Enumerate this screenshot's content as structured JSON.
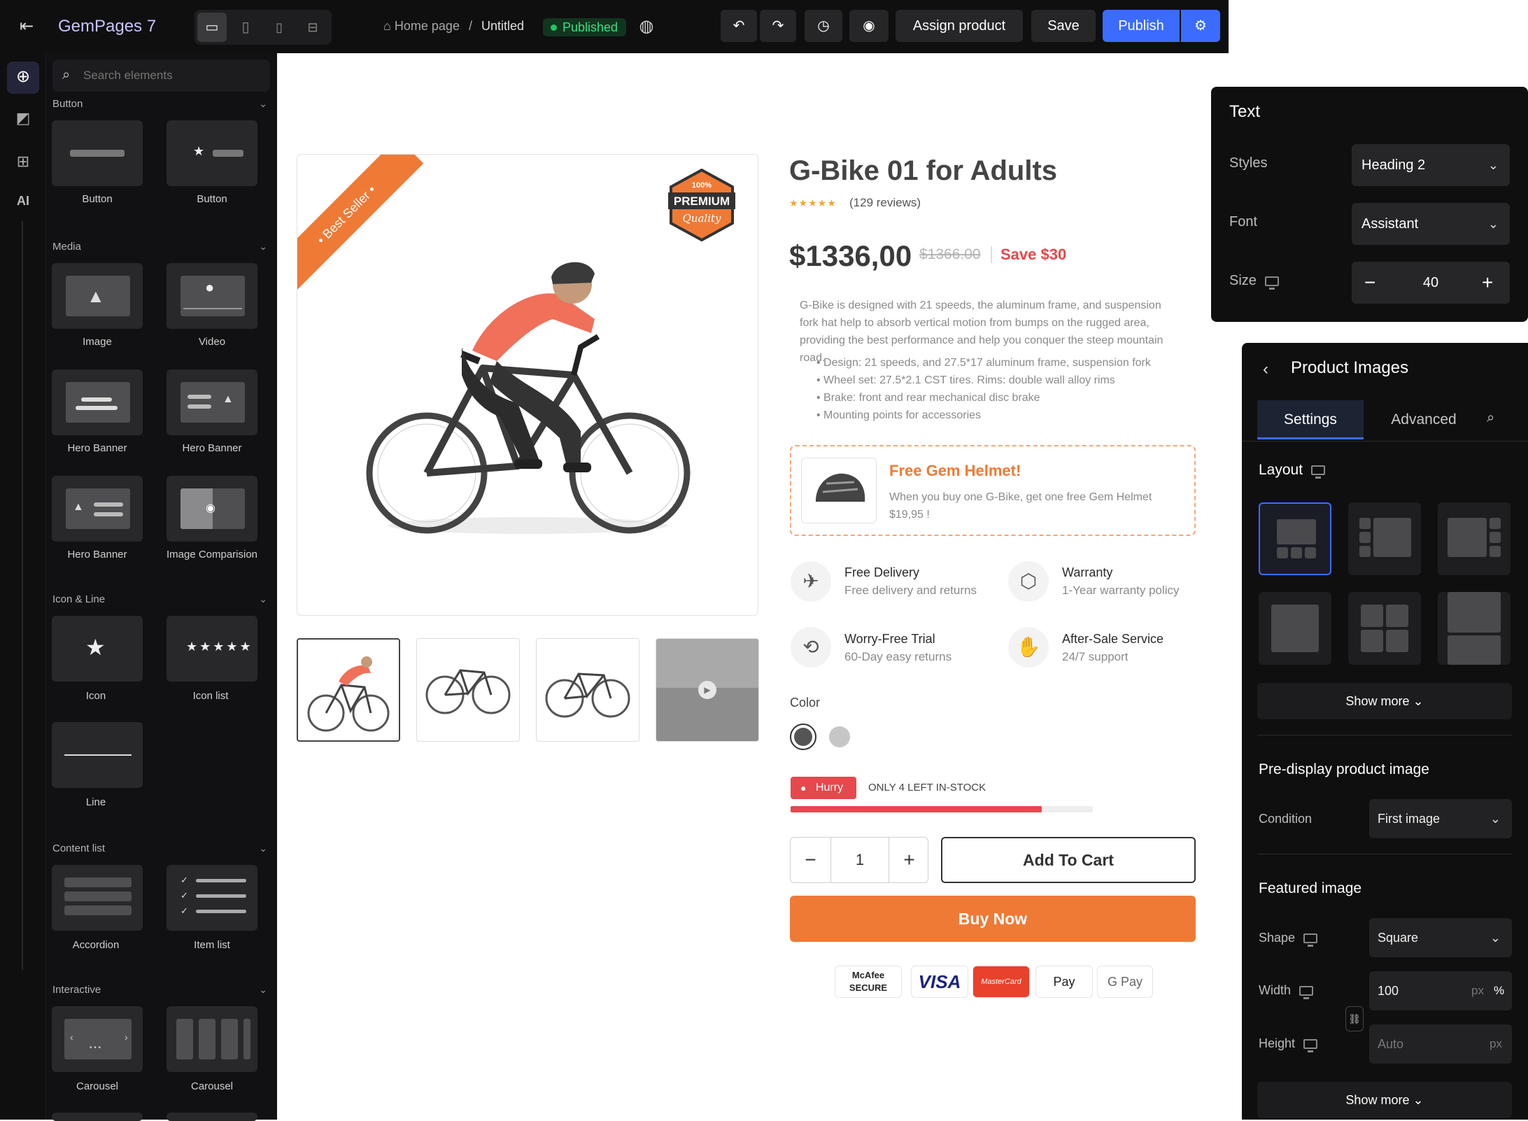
{
  "topbar": {
    "app_name": "GemPages 7",
    "breadcrumb": {
      "home": "Home page",
      "separator": "/",
      "page": "Untitled"
    },
    "status_badge": "Published",
    "assign_label": "Assign product",
    "save_label": "Save",
    "publish_label": "Publish"
  },
  "sidebar": {
    "search_placeholder": "Search elements",
    "sections": {
      "button": "Button",
      "media": "Media",
      "icon_line": "Icon & Line",
      "content_list": "Content list",
      "interactive": "Interactive"
    },
    "tiles": {
      "button1": "Button",
      "button2": "Button",
      "image": "Image",
      "video": "Video",
      "hero1": "Hero Banner",
      "hero2": "Hero Banner",
      "hero3": "Hero Banner",
      "image_comparison": "Image Comparision",
      "icon": "Icon",
      "icon_list": "Icon list",
      "line": "Line",
      "accordion": "Accordion",
      "item_list": "Item list",
      "carousel1": "Carousel",
      "carousel2": "Carousel"
    }
  },
  "product": {
    "ribbon": "Best Seller",
    "badge": {
      "top": "100%",
      "main": "PREMIUM",
      "script": "Quality"
    },
    "title": "G-Bike 01 for Adults",
    "rating": 5,
    "reviews": "(129 reviews)",
    "price": "$1336,00",
    "compare_price": "$1366.00",
    "save": "Save $30",
    "description": "G-Bike is designed with 21 speeds, the aluminum frame, and suspension fork hat help to absorb vertical motion from bumps on the rugged area, providing the best performance and help you conquer the steep mountain road.",
    "bullets": [
      "Design: 21 speeds, and 27.5*17 aluminum frame, suspension fork",
      "Wheel set: 27.5*2.1 CST tires. Rims: double wall alloy rims",
      "Brake: front and rear mechanical disc brake",
      "Mounting points for accessories"
    ],
    "promo": {
      "title": "Free Gem Helmet!",
      "text": "When you buy one G-Bike, get one free Gem Helmet $19,95 !"
    },
    "features": [
      {
        "title": "Free Delivery",
        "sub": "Free delivery and returns",
        "icon": "plane-icon"
      },
      {
        "title": "Warranty",
        "sub": "1-Year warranty policy",
        "icon": "box-icon"
      },
      {
        "title": "Worry-Free Trial",
        "sub": "60-Day easy returns",
        "icon": "return-box-icon"
      },
      {
        "title": "After-Sale Service",
        "sub": "24/7 support",
        "icon": "hand-box-icon"
      }
    ],
    "color_label": "Color",
    "hurry_label": "Hurry",
    "stock_text": "ONLY 4 LEFT IN-STOCK",
    "stock_fill": 0.83,
    "quantity": "1",
    "add_to_cart": "Add To Cart",
    "buy_now": "Buy Now",
    "payments": {
      "mcafee": "McAfee SECURE",
      "visa": "VISA",
      "mastercard": "MasterCard",
      "applepay": "Pay",
      "gpay": "G Pay"
    },
    "colors": {
      "accent": "#ef7a36",
      "price_red": "#e5484d",
      "publish_blue": "#3b6cff",
      "published_green": "#22c55e"
    }
  },
  "text_panel": {
    "title": "Text",
    "styles_label": "Styles",
    "styles_value": "Heading 2",
    "font_label": "Font",
    "font_value": "Assistant",
    "size_label": "Size",
    "size_value": "40"
  },
  "images_panel": {
    "title": "Product Images",
    "tab_settings": "Settings",
    "tab_advanced": "Advanced",
    "layout_label": "Layout",
    "show_more": "Show more",
    "pre_display_title": "Pre-display product image",
    "condition_label": "Condition",
    "condition_value": "First image",
    "featured_title": "Featured image",
    "shape_label": "Shape",
    "shape_value": "Square",
    "width_label": "Width",
    "width_value": "100",
    "width_unit_px": "px",
    "width_unit_pct": "%",
    "height_label": "Height",
    "height_placeholder": "Auto",
    "height_unit": "px",
    "show_more_2": "Show more"
  }
}
